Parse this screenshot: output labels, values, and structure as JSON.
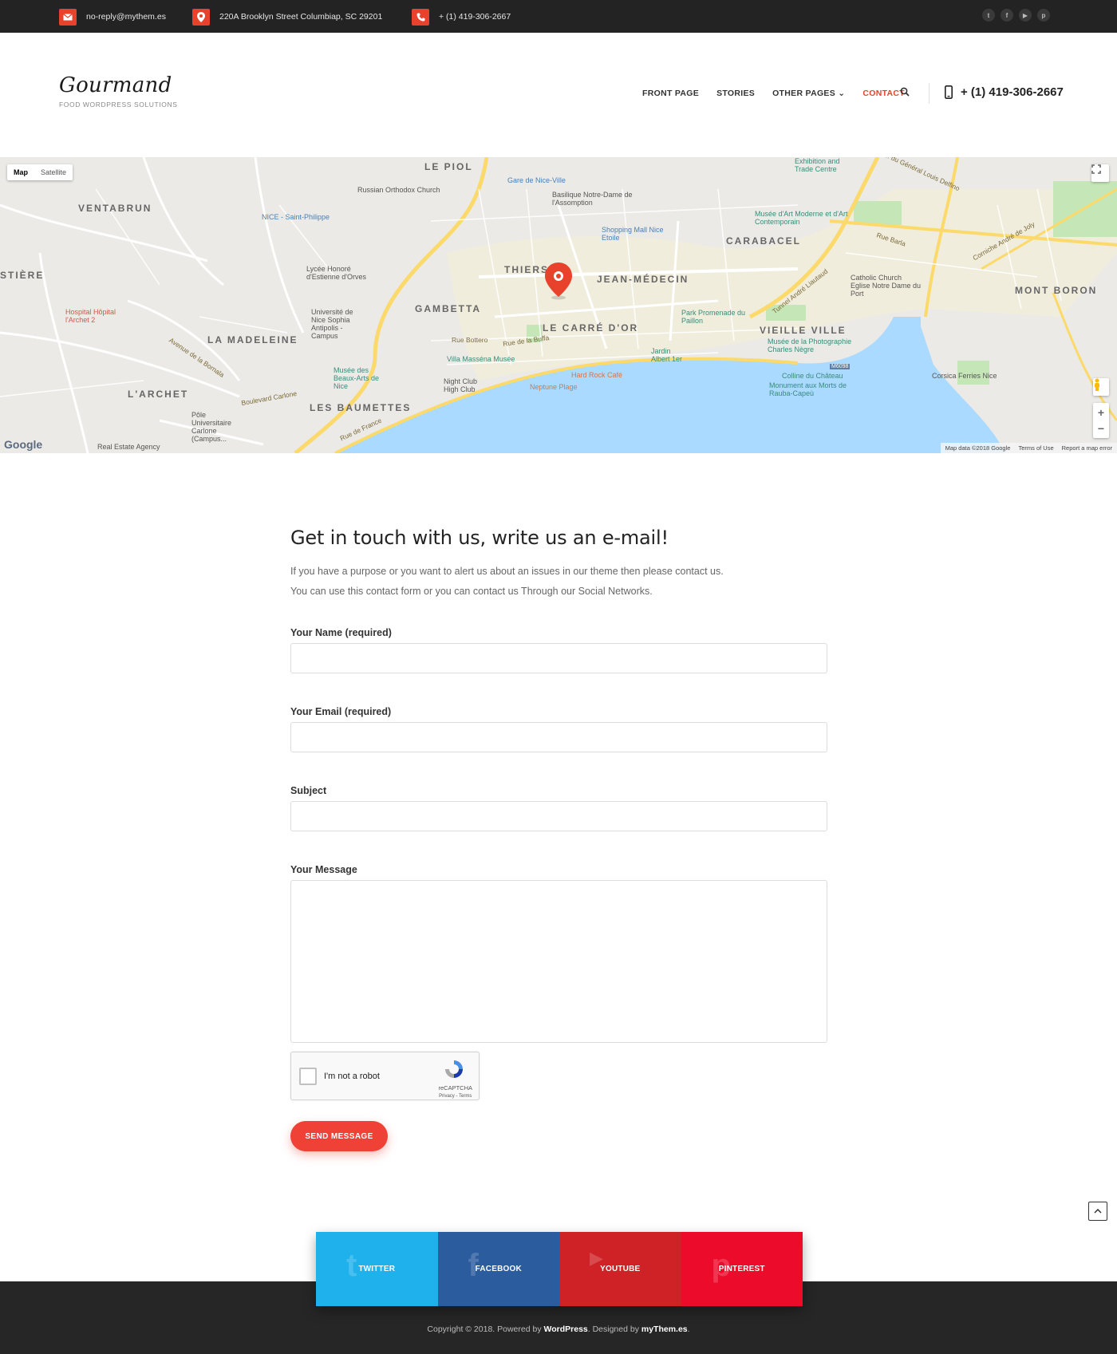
{
  "topbar": {
    "email": "no-reply@mythem.es",
    "address": "220A Brooklyn Street Columbiap, SC 29201",
    "phone": "+ (1) 419-306-2667",
    "social": [
      "twitter-icon",
      "facebook-icon",
      "youtube-icon",
      "pinterest-icon"
    ],
    "accent": "#e8412c"
  },
  "header": {
    "brand": "Gourmand",
    "tagline": "FOOD WORDPRESS SOLUTIONS",
    "menu": [
      {
        "label": "FRONT PAGE"
      },
      {
        "label": "STORIES"
      },
      {
        "label": "OTHER PAGES ⌄"
      },
      {
        "label": "CONTACT",
        "active": true
      }
    ],
    "phone": "+ (1) 419-306-2667"
  },
  "map": {
    "type_buttons": [
      "Map",
      "Satellite"
    ],
    "selected_type": "Map",
    "provider": "Google",
    "footer": [
      "Map data ©2018 Google",
      "Terms of Use",
      "Report a map error"
    ],
    "labels": {
      "ventabrun": "VENTABRUN",
      "le_piol": "LE PIOL",
      "thiers": "THIERS",
      "jean_medecin": "JEAN-MÉDECIN",
      "carabacel": "CARABACEL",
      "gambetta": "GAMBETTA",
      "le_carre_dor": "LE CARRÉ D'OR",
      "vieille_ville": "VIEILLE VILLE",
      "la_madeleine": "LA MADELEINE",
      "larchet": "L'ARCHET",
      "les_baumettes": "LES BAUMETTES",
      "mont_boron": "MONT BORON",
      "stiere": "STIÈRE",
      "gare": "Gare de Nice-Ville",
      "basilique": "Basilique Notre-Dame de l'Assomption",
      "russian": "Russian Orthodox Church",
      "nice_st_philippe": "NICE - Saint-Philippe",
      "shopping": "Shopping Mall Nice Etoile",
      "musee_art": "Musée d'Art Moderne et d'Art Contemporain",
      "exhibition": "Exhibition and Trade Centre",
      "lycee": "Lycée Honoré d'Estienne d'Orves",
      "hospital": "Hospital Hôpital l'Archet 2",
      "universite": "Université de Nice Sophia Antipolis - Campus",
      "park": "Park Promenade du Paillon",
      "catholic": "Catholic Church Eglise Notre Dame du Port",
      "musee_photo": "Musée de la Photographie Charles Nègre",
      "villa": "Villa Masséna Musée",
      "beaux_arts": "Musée des Beaux-Arts de Nice",
      "night_club": "Night Club High Club",
      "hard_rock": "Hard Rock Café",
      "neptune": "Neptune Plage",
      "jardin": "Jardin Albert 1er",
      "colline": "Colline du Château",
      "monument": "Monument aux Morts de Rauba-Capeù",
      "corsica": "Corsica Ferries Nice",
      "pole": "Pôle Universitaire Carlone (Campus...",
      "real_estate": "Real Estate Agency",
      "tunnel": "Tunnel André Liautaud",
      "rue_barla": "Rue Barla",
      "corniche": "Corniche André de Joly",
      "rue_bottero": "Rue Bottero",
      "rue_buffa": "Rue de la Buffa",
      "bd_carlone": "Boulevard Carlone",
      "av_bornala": "Avenue de la Bornala",
      "rue_france": "Rue de France",
      "general_delfino": "Av. du Général Louis Delfino",
      "m6098": "M6098"
    }
  },
  "contact": {
    "title": "Get in touch with us, write us an e-mail!",
    "intro_line1": "If you have a purpose or you want to alert us about an issues in our theme then please contact us.",
    "intro_line2": "You can use this contact form or you can contact us Through our Social Networks.",
    "fields": {
      "name_label": "Your Name (required)",
      "name_value": "",
      "email_label": "Your Email (required)",
      "email_value": "",
      "subject_label": "Subject",
      "subject_value": "",
      "message_label": "Your Message",
      "message_value": ""
    },
    "captcha": {
      "label": "I'm not a robot",
      "brand": "reCAPTCHA",
      "links": "Privacy - Terms",
      "checked": false
    },
    "send_label": "SEND MESSAGE",
    "send_color": "#ef4136"
  },
  "social_strip": [
    {
      "label": "TWITTER",
      "icon": "twitter-icon",
      "color": "#1fb1eb"
    },
    {
      "label": "FACEBOOK",
      "icon": "facebook-icon",
      "color": "#2b5c9e"
    },
    {
      "label": "YOUTUBE",
      "icon": "youtube-icon",
      "color": "#cf2227"
    },
    {
      "label": "PINTEREST",
      "icon": "pinterest-icon",
      "color": "#ec0b2a"
    }
  ],
  "footer": {
    "copyright_prefix": "Copyright © 2018. Powered by ",
    "wordpress": "WordPress",
    "designed_by": ". Designed by ",
    "mythemes": "myThem.es",
    "suffix": "."
  }
}
